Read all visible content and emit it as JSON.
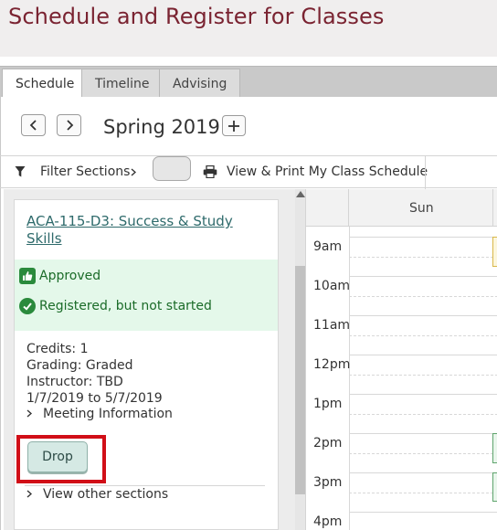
{
  "header": {
    "title": "Schedule and Register for Classes"
  },
  "tabs": [
    {
      "label": "Schedule",
      "active": true
    },
    {
      "label": "Timeline",
      "active": false
    },
    {
      "label": "Advising",
      "active": false
    }
  ],
  "term": {
    "name": "Spring 2019",
    "prev_icon": "chevron-left-icon",
    "next_icon": "chevron-right-icon",
    "add_icon": "plus-icon"
  },
  "toolbar": {
    "filter_label": "Filter Sections",
    "print_label": "View & Print My Class Schedule",
    "filter_icon": "filter-icon",
    "print_icon": "printer-icon"
  },
  "course": {
    "title": "ACA-115-D3: Success & Study Skills",
    "status_approved": "Approved",
    "status_registered": "Registered, but not started",
    "credits": "Credits: 1",
    "grading": "Grading: Graded",
    "instructor": "Instructor: TBD",
    "dates": "1/7/2019 to 5/7/2019",
    "meeting_info_label": "Meeting Information",
    "drop_label": "Drop",
    "other_sections_label": "View other sections"
  },
  "calendar": {
    "day": "Sun",
    "hours": [
      "9am",
      "10am",
      "11am",
      "12pm",
      "1pm",
      "2pm",
      "3pm",
      "4pm"
    ]
  },
  "colors": {
    "title": "#7a2331",
    "link": "#2e6a6b",
    "status_bg": "#e4f8ea",
    "status_text": "#1a6b28",
    "highlight": "#d10e17",
    "event_yellow": "#d9b84a",
    "event_green": "#5fa56d"
  }
}
